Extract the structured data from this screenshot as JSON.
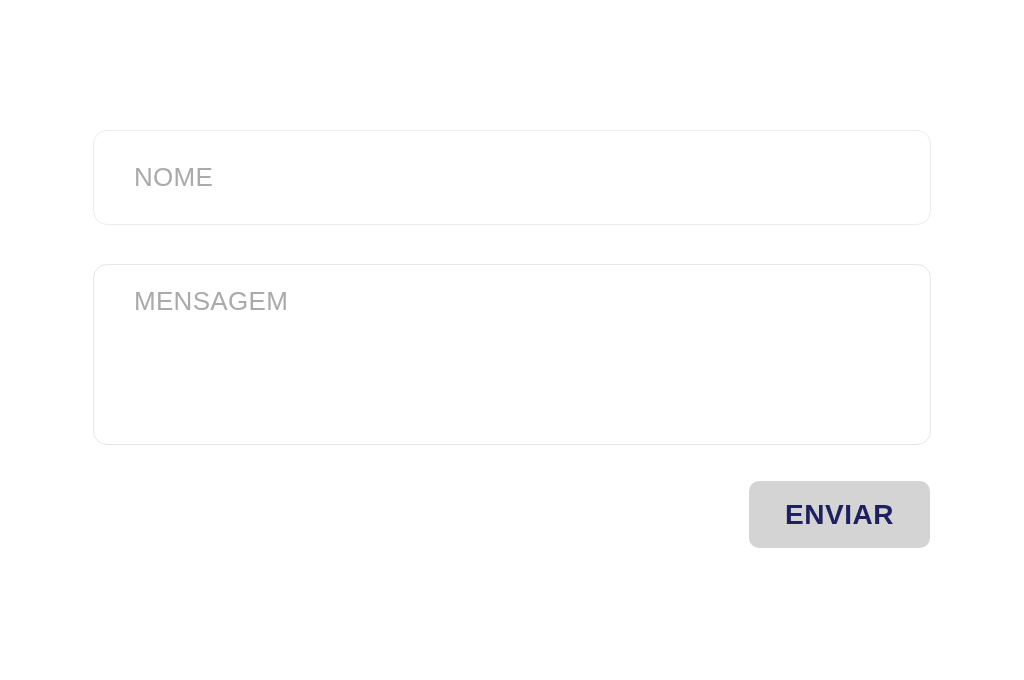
{
  "form": {
    "fields": [
      {
        "kind": "text",
        "placeholder": "NOME"
      },
      {
        "kind": "textarea",
        "placeholder": "MENSAGEM"
      }
    ],
    "submit_button": {
      "label": "ENVIAR"
    }
  }
}
